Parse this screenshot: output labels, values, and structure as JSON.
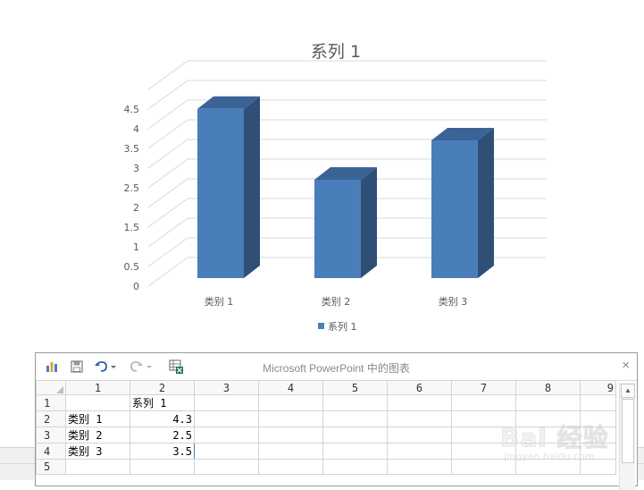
{
  "chart_data": {
    "type": "bar",
    "title": "系列 1",
    "categories": [
      "类别 1",
      "类别 2",
      "类别 3"
    ],
    "series": [
      {
        "name": "系列 1",
        "values": [
          4.3,
          2.5,
          3.5
        ]
      }
    ],
    "y_ticks": [
      "0",
      "0.5",
      "1",
      "1.5",
      "2",
      "2.5",
      "3",
      "3.5",
      "4",
      "4.5"
    ],
    "ylim": [
      0,
      4.5
    ],
    "grid": true,
    "style": "3d-column",
    "legend_position": "bottom",
    "colors": {
      "front": "#4a7ebb",
      "side": "#2f4f77",
      "top": "#3b6496"
    }
  },
  "datasheet": {
    "title": "Microsoft PowerPoint 中的图表",
    "close_glyph": "×",
    "column_headers": [
      "1",
      "2",
      "3",
      "4",
      "5",
      "6",
      "7",
      "8",
      "9"
    ],
    "rows": [
      {
        "num": "1",
        "cells": [
          "",
          "系列 1",
          "",
          "",
          "",
          "",
          "",
          "",
          ""
        ]
      },
      {
        "num": "2",
        "cells": [
          "类别 1",
          "4.3",
          "",
          "",
          "",
          "",
          "",
          "",
          ""
        ]
      },
      {
        "num": "3",
        "cells": [
          "类别 2",
          "2.5",
          "",
          "",
          "",
          "",
          "",
          "",
          ""
        ]
      },
      {
        "num": "4",
        "cells": [
          "类别 3",
          "3.5",
          "",
          "",
          "",
          "",
          "",
          "",
          ""
        ]
      },
      {
        "num": "5",
        "cells": [
          "",
          "",
          "",
          "",
          "",
          "",
          "",
          "",
          ""
        ]
      }
    ],
    "toolbar_icons": [
      "chart-icon",
      "save-icon",
      "undo-icon",
      "redo-icon",
      "excel-icon"
    ]
  },
  "watermark": {
    "main": "Bai 经验",
    "sub": "jingyan.baidu.com"
  }
}
